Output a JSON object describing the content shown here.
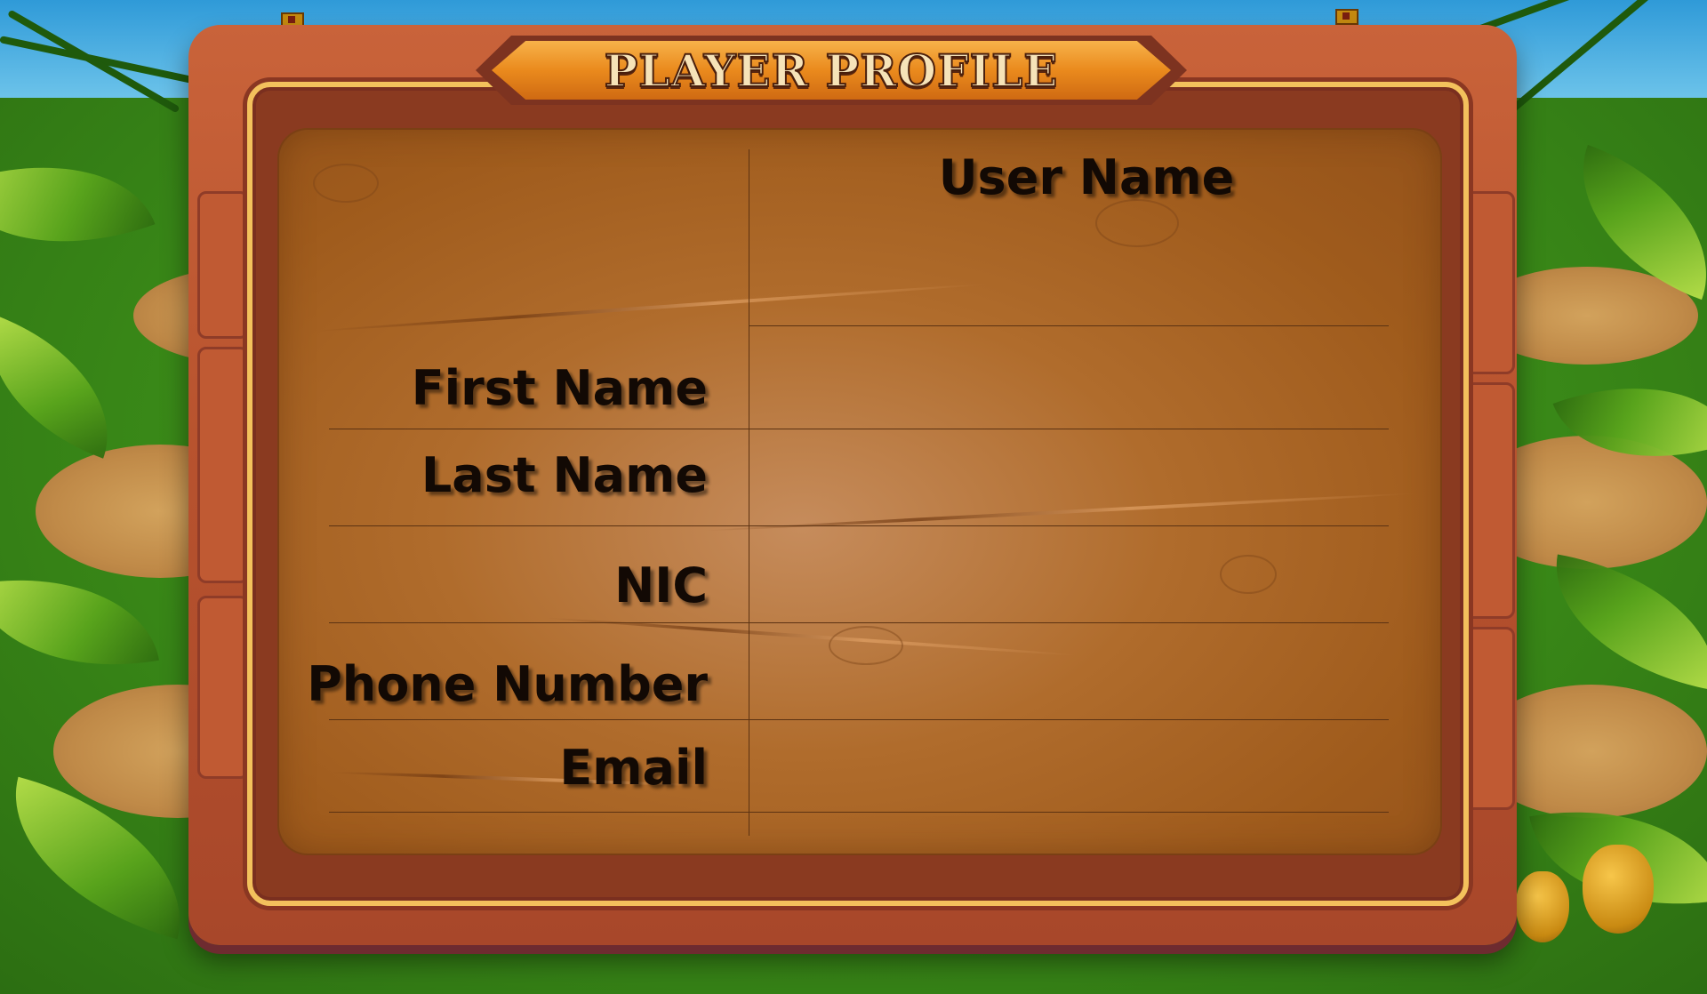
{
  "screen": {
    "title": "PLAYER PROFILE"
  },
  "profile": {
    "user_name_label": "User Name",
    "user_name_value": "",
    "fields": [
      {
        "label": "First Name",
        "value": ""
      },
      {
        "label": "Last Name",
        "value": ""
      },
      {
        "label": "NIC",
        "value": ""
      },
      {
        "label": "Phone Number",
        "value": ""
      },
      {
        "label": "Email",
        "value": ""
      }
    ]
  },
  "colors": {
    "wood_frame": "#b8532e",
    "board": "#b06c2c",
    "banner": "#ea8a1d",
    "trim": "#f3c15c"
  }
}
